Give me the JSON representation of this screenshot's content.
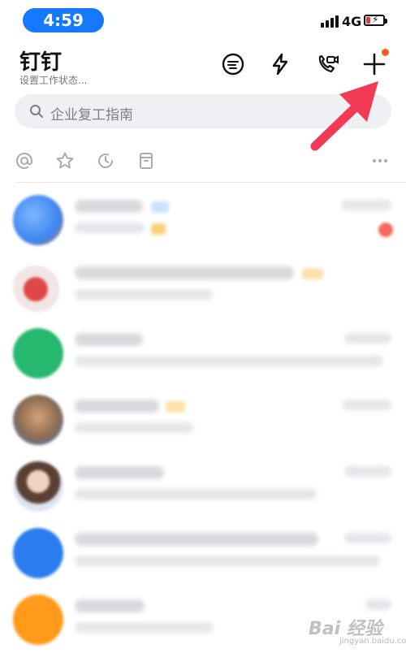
{
  "status_bar": {
    "time": "4:59",
    "network": "4G"
  },
  "header": {
    "title": "钉钉",
    "subtitle": "设置工作状态..."
  },
  "search": {
    "placeholder": "企业复工指南"
  },
  "watermark": {
    "text": "Bai 经验",
    "url_text": "jingyan.baidu.com"
  },
  "colors": {
    "accent": "#1677ff",
    "arrow": "#f23a55",
    "notification_dot": "#ff5a1f"
  },
  "icons": [
    "chat-bubble-icon",
    "lightning-icon",
    "video-call-icon",
    "plus-icon",
    "at-icon",
    "star-icon",
    "clock-icon",
    "archive-icon",
    "more-icon"
  ]
}
